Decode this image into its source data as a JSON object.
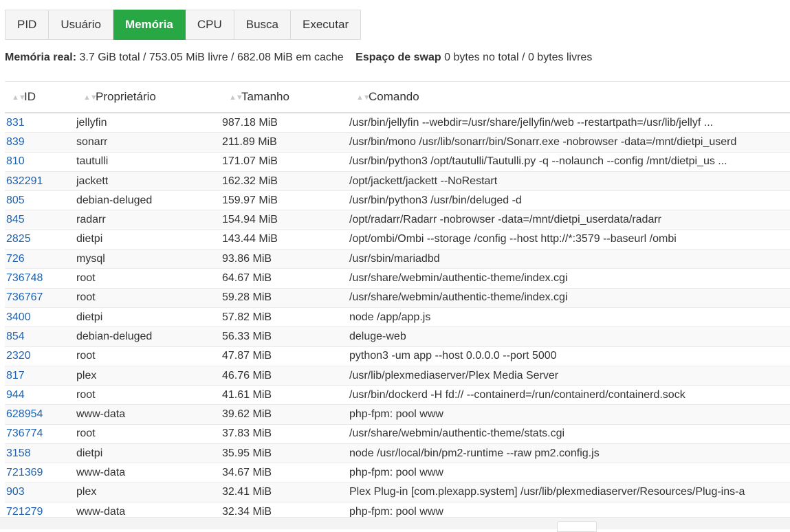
{
  "tabs": [
    {
      "label": "PID",
      "active": false
    },
    {
      "label": "Usuário",
      "active": false
    },
    {
      "label": "Memória",
      "active": true
    },
    {
      "label": "CPU",
      "active": false
    },
    {
      "label": "Busca",
      "active": false
    },
    {
      "label": "Executar",
      "active": false
    }
  ],
  "summary": {
    "real_label": "Memória real:",
    "real_value": "3.7 GiB total / 753.05 MiB livre / 682.08 MiB em cache",
    "swap_label": "Espaço de swap",
    "swap_value": "0 bytes no total / 0 bytes livres"
  },
  "columns": {
    "id": "ID",
    "owner": "Proprietário",
    "size": "Tamanho",
    "command": "Comando",
    "sort_icon": "sort-icon"
  },
  "accent_color": "#28a745",
  "link_color": "#1e62b0",
  "rows": [
    {
      "pid": "831",
      "owner": "jellyfin",
      "size": "987.18 MiB",
      "cmd": "/usr/bin/jellyfin --webdir=/usr/share/jellyfin/web --restartpath=/usr/lib/jellyf ..."
    },
    {
      "pid": "839",
      "owner": "sonarr",
      "size": "211.89 MiB",
      "cmd": "/usr/bin/mono /usr/lib/sonarr/bin/Sonarr.exe -nobrowser -data=/mnt/dietpi_userd"
    },
    {
      "pid": "810",
      "owner": "tautulli",
      "size": "171.07 MiB",
      "cmd": "/usr/bin/python3 /opt/tautulli/Tautulli.py -q --nolaunch --config /mnt/dietpi_us ..."
    },
    {
      "pid": "632291",
      "owner": "jackett",
      "size": "162.32 MiB",
      "cmd": "/opt/jackett/jackett --NoRestart"
    },
    {
      "pid": "805",
      "owner": "debian-deluged",
      "size": "159.97 MiB",
      "cmd": "/usr/bin/python3 /usr/bin/deluged -d"
    },
    {
      "pid": "845",
      "owner": "radarr",
      "size": "154.94 MiB",
      "cmd": "/opt/radarr/Radarr -nobrowser -data=/mnt/dietpi_userdata/radarr"
    },
    {
      "pid": "2825",
      "owner": "dietpi",
      "size": "143.44 MiB",
      "cmd": "/opt/ombi/Ombi --storage /config --host http://*:3579 --baseurl /ombi"
    },
    {
      "pid": "726",
      "owner": "mysql",
      "size": "93.86 MiB",
      "cmd": "/usr/sbin/mariadbd"
    },
    {
      "pid": "736748",
      "owner": "root",
      "size": "64.67 MiB",
      "cmd": "/usr/share/webmin/authentic-theme/index.cgi"
    },
    {
      "pid": "736767",
      "owner": "root",
      "size": "59.28 MiB",
      "cmd": "/usr/share/webmin/authentic-theme/index.cgi"
    },
    {
      "pid": "3400",
      "owner": "dietpi",
      "size": "57.82 MiB",
      "cmd": "node /app/app.js"
    },
    {
      "pid": "854",
      "owner": "debian-deluged",
      "size": "56.33 MiB",
      "cmd": "deluge-web"
    },
    {
      "pid": "2320",
      "owner": "root",
      "size": "47.87 MiB",
      "cmd": "python3 -um app --host 0.0.0.0 --port 5000"
    },
    {
      "pid": "817",
      "owner": "plex",
      "size": "46.76 MiB",
      "cmd": "/usr/lib/plexmediaserver/Plex Media Server"
    },
    {
      "pid": "944",
      "owner": "root",
      "size": "41.61 MiB",
      "cmd": "/usr/bin/dockerd -H fd:// --containerd=/run/containerd/containerd.sock"
    },
    {
      "pid": "628954",
      "owner": "www-data",
      "size": "39.62 MiB",
      "cmd": "php-fpm: pool www"
    },
    {
      "pid": "736774",
      "owner": "root",
      "size": "37.83 MiB",
      "cmd": "/usr/share/webmin/authentic-theme/stats.cgi"
    },
    {
      "pid": "3158",
      "owner": "dietpi",
      "size": "35.95 MiB",
      "cmd": "node /usr/local/bin/pm2-runtime --raw pm2.config.js"
    },
    {
      "pid": "721369",
      "owner": "www-data",
      "size": "34.67 MiB",
      "cmd": "php-fpm: pool www"
    },
    {
      "pid": "903",
      "owner": "plex",
      "size": "32.41 MiB",
      "cmd": "Plex Plug-in [com.plexapp.system] /usr/lib/plexmediaserver/Resources/Plug-ins-a"
    },
    {
      "pid": "721279",
      "owner": "www-data",
      "size": "32.34 MiB",
      "cmd": "php-fpm: pool www"
    }
  ]
}
